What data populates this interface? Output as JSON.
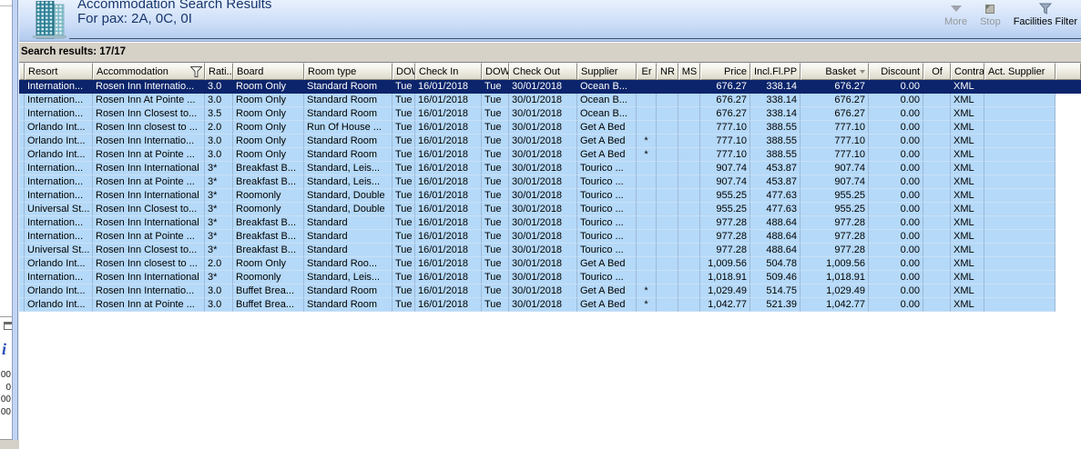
{
  "window": {
    "header": {
      "title": "Accommodation Search Results",
      "pax_line": "For pax: 2A, 0C, 0I",
      "icon": "building-icon"
    },
    "toolbar": {
      "buttons": [
        {
          "label": "More",
          "icon": "more-dropdown-icon",
          "enabled": false
        },
        {
          "label": "Stop",
          "icon": "stop-icon",
          "enabled": false
        },
        {
          "label": "Facilities Filter",
          "icon": "filter-funnel-icon",
          "enabled": true
        }
      ]
    },
    "results_summary": "Search results: 17/17"
  },
  "table": {
    "columns": [
      {
        "label": "Resort"
      },
      {
        "label": "Accommodation",
        "filter_icon": true
      },
      {
        "label": "Rati..."
      },
      {
        "label": "Board"
      },
      {
        "label": "Room type"
      },
      {
        "label": "DOW"
      },
      {
        "label": "Check In"
      },
      {
        "label": "DOW"
      },
      {
        "label": "Check Out"
      },
      {
        "label": "Supplier"
      },
      {
        "label": "Er"
      },
      {
        "label": "NR"
      },
      {
        "label": "MS"
      },
      {
        "label": "Price"
      },
      {
        "label": "Incl.Fl.PP"
      },
      {
        "label": "Basket",
        "sort_icon": true
      },
      {
        "label": "Discount"
      },
      {
        "label": "Of"
      },
      {
        "label": "Contract"
      },
      {
        "label": "Act. Supplier"
      }
    ],
    "rows": [
      {
        "selected": true,
        "cells": [
          "Internation...",
          "Rosen Inn Internatio...",
          "3.0",
          "Room Only",
          "Standard Room",
          "Tue",
          "16/01/2018",
          "Tue",
          "30/01/2018",
          "Ocean B...",
          "",
          "",
          "",
          "676.27",
          "338.14",
          "676.27",
          "0.00",
          "",
          "XML",
          ""
        ]
      },
      {
        "selected": false,
        "cells": [
          "Internation...",
          "Rosen Inn At Pointe ...",
          "3.0",
          "Room Only",
          "Standard Room",
          "Tue",
          "16/01/2018",
          "Tue",
          "30/01/2018",
          "Ocean B...",
          "",
          "",
          "",
          "676.27",
          "338.14",
          "676.27",
          "0.00",
          "",
          "XML",
          ""
        ]
      },
      {
        "selected": false,
        "cells": [
          "Internation...",
          "Rosen Inn Closest to...",
          "3.5",
          "Room Only",
          "Standard Room",
          "Tue",
          "16/01/2018",
          "Tue",
          "30/01/2018",
          "Ocean B...",
          "",
          "",
          "",
          "676.27",
          "338.14",
          "676.27",
          "0.00",
          "",
          "XML",
          ""
        ]
      },
      {
        "selected": false,
        "cells": [
          "Orlando Int...",
          "Rosen Inn closest to ...",
          "2.0",
          "Room Only",
          "Run Of House ...",
          "Tue",
          "16/01/2018",
          "Tue",
          "30/01/2018",
          "Get A Bed",
          "",
          "",
          "",
          "777.10",
          "388.55",
          "777.10",
          "0.00",
          "",
          "XML",
          ""
        ]
      },
      {
        "selected": false,
        "cells": [
          "Orlando Int...",
          "Rosen Inn Internatio...",
          "3.0",
          "Room Only",
          "Standard Room",
          "Tue",
          "16/01/2018",
          "Tue",
          "30/01/2018",
          "Get A Bed",
          "*",
          "",
          "",
          "777.10",
          "388.55",
          "777.10",
          "0.00",
          "",
          "XML",
          ""
        ]
      },
      {
        "selected": false,
        "cells": [
          "Orlando Int...",
          "Rosen Inn at Pointe ...",
          "3.0",
          "Room Only",
          "Standard Room",
          "Tue",
          "16/01/2018",
          "Tue",
          "30/01/2018",
          "Get A Bed",
          "*",
          "",
          "",
          "777.10",
          "388.55",
          "777.10",
          "0.00",
          "",
          "XML",
          ""
        ]
      },
      {
        "selected": false,
        "cells": [
          "Internation...",
          "Rosen Inn International",
          "3*",
          "Breakfast B...",
          "Standard, Leis...",
          "Tue",
          "16/01/2018",
          "Tue",
          "30/01/2018",
          "Tourico ...",
          "",
          "",
          "",
          "907.74",
          "453.87",
          "907.74",
          "0.00",
          "",
          "XML",
          ""
        ]
      },
      {
        "selected": false,
        "cells": [
          "Internation...",
          "Rosen Inn at Pointe ...",
          "3*",
          "Breakfast B...",
          "Standard, Leis...",
          "Tue",
          "16/01/2018",
          "Tue",
          "30/01/2018",
          "Tourico ...",
          "",
          "",
          "",
          "907.74",
          "453.87",
          "907.74",
          "0.00",
          "",
          "XML",
          ""
        ]
      },
      {
        "selected": false,
        "cells": [
          "Internation...",
          "Rosen Inn International",
          "3*",
          "Roomonly",
          "Standard, Double",
          "Tue",
          "16/01/2018",
          "Tue",
          "30/01/2018",
          "Tourico ...",
          "",
          "",
          "",
          "955.25",
          "477.63",
          "955.25",
          "0.00",
          "",
          "XML",
          ""
        ]
      },
      {
        "selected": false,
        "cells": [
          "Universal St...",
          "Rosen Inn Closest to...",
          "3*",
          "Roomonly",
          "Standard, Double",
          "Tue",
          "16/01/2018",
          "Tue",
          "30/01/2018",
          "Tourico ...",
          "",
          "",
          "",
          "955.25",
          "477.63",
          "955.25",
          "0.00",
          "",
          "XML",
          ""
        ]
      },
      {
        "selected": false,
        "cells": [
          "Internation...",
          "Rosen Inn International",
          "3*",
          "Breakfast B...",
          "Standard",
          "Tue",
          "16/01/2018",
          "Tue",
          "30/01/2018",
          "Tourico ...",
          "",
          "",
          "",
          "977.28",
          "488.64",
          "977.28",
          "0.00",
          "",
          "XML",
          ""
        ]
      },
      {
        "selected": false,
        "cells": [
          "Internation...",
          "Rosen Inn at Pointe ...",
          "3*",
          "Breakfast B...",
          "Standard",
          "Tue",
          "16/01/2018",
          "Tue",
          "30/01/2018",
          "Tourico ...",
          "",
          "",
          "",
          "977.28",
          "488.64",
          "977.28",
          "0.00",
          "",
          "XML",
          ""
        ]
      },
      {
        "selected": false,
        "cells": [
          "Universal St...",
          "Rosen Inn Closest to...",
          "3*",
          "Breakfast B...",
          "Standard",
          "Tue",
          "16/01/2018",
          "Tue",
          "30/01/2018",
          "Tourico ...",
          "",
          "",
          "",
          "977.28",
          "488.64",
          "977.28",
          "0.00",
          "",
          "XML",
          ""
        ]
      },
      {
        "selected": false,
        "cells": [
          "Orlando Int...",
          "Rosen Inn closest to ...",
          "2.0",
          "Room Only",
          "Standard Roo...",
          "Tue",
          "16/01/2018",
          "Tue",
          "30/01/2018",
          "Get A Bed",
          "",
          "",
          "",
          "1,009.56",
          "504.78",
          "1,009.56",
          "0.00",
          "",
          "XML",
          ""
        ]
      },
      {
        "selected": false,
        "cells": [
          "Internation...",
          "Rosen Inn International",
          "3*",
          "Roomonly",
          "Standard, Leis...",
          "Tue",
          "16/01/2018",
          "Tue",
          "30/01/2018",
          "Tourico ...",
          "",
          "",
          "",
          "1,018.91",
          "509.46",
          "1,018.91",
          "0.00",
          "",
          "XML",
          ""
        ]
      },
      {
        "selected": false,
        "cells": [
          "Orlando Int...",
          "Rosen Inn Internatio...",
          "3.0",
          "Buffet Brea...",
          "Standard Room",
          "Tue",
          "16/01/2018",
          "Tue",
          "30/01/2018",
          "Get A Bed",
          "*",
          "",
          "",
          "1,029.49",
          "514.75",
          "1,029.49",
          "0.00",
          "",
          "XML",
          ""
        ]
      },
      {
        "selected": false,
        "cells": [
          "Orlando Int...",
          "Rosen Inn at Pointe ...",
          "3.0",
          "Buffet Brea...",
          "Standard Room",
          "Tue",
          "16/01/2018",
          "Tue",
          "30/01/2018",
          "Get A Bed",
          "*",
          "",
          "",
          "1,042.77",
          "521.39",
          "1,042.77",
          "0.00",
          "",
          "XML",
          ""
        ]
      }
    ]
  },
  "background_window": {
    "partial_letter": "i",
    "clipped_values": [
      "00",
      "0",
      "00",
      "00"
    ]
  },
  "colors": {
    "selection_bg": "#0b246b",
    "row_bg": "#b5d9f8",
    "title_text": "#17366e",
    "header_band_top": "#e8f1fd",
    "header_band_bottom": "#b2cbee",
    "strip_bg": "#d6d2c8"
  }
}
